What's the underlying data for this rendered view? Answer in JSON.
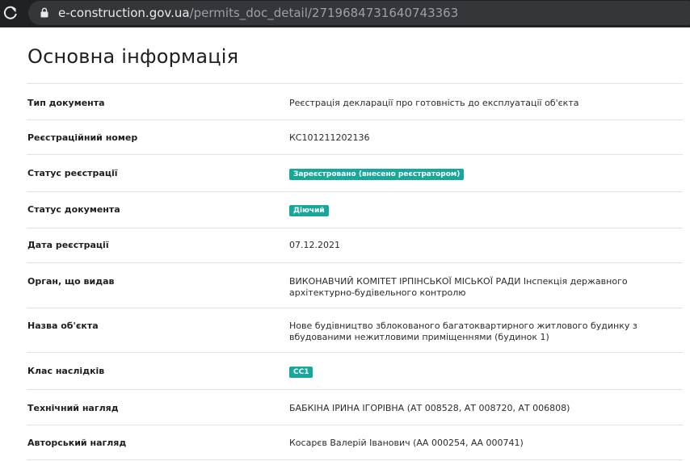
{
  "browser": {
    "url_host": "e-construction.gov.ua",
    "url_path": "/permits_doc_detail/2719684731640743363"
  },
  "page": {
    "title": "Основна інформація"
  },
  "rows": [
    {
      "label": "Тип документа",
      "value": "Реєстрація декларації про готовність до експлуатації об'єкта"
    },
    {
      "label": "Реєстраційний номер",
      "value": "КС101211202136"
    },
    {
      "label": "Статус реєстрації",
      "badge": "Зареєстровано (внесено реєстратором)"
    },
    {
      "label": "Статус документа",
      "badge": "Діючий"
    },
    {
      "label": "Дата реєстрації",
      "value": "07.12.2021"
    },
    {
      "label": "Орган, що видав",
      "value": "ВИКОНАВЧИЙ КОМІТЕТ ІРПІНСЬКОЇ МІСЬКОЇ РАДИ Інспекція державного архітектурно-будівельного контролю"
    },
    {
      "label": "Назва об'єкта",
      "value": "Нове будівництво зблокованого багатоквартирного житлового будинку з вбудованими нежитловими приміщеннями (будинок 1)"
    },
    {
      "label": "Клас наслідків",
      "badge": "СС1"
    },
    {
      "label": "Технічний нагляд",
      "value": "БАБКІНА ІРИНА ІГОРІВНА (АТ 008528, АТ 008720, АТ 006808)"
    },
    {
      "label": "Авторський нагляд",
      "value": "Косарєв Валерій Іванович (АА 000254, АА 000741)"
    }
  ],
  "colors": {
    "badge": "#17a89b",
    "chrome": "#202124"
  }
}
